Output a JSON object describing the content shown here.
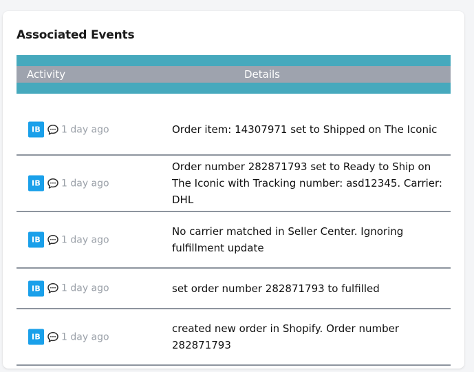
{
  "panel": {
    "title": "Associated Events"
  },
  "table": {
    "headers": {
      "activity": "Activity",
      "details": "Details"
    },
    "rows": [
      {
        "badge": "IB",
        "icon": "comment-icon",
        "time": "1 day ago",
        "details": "Order item: 14307971 set to Shipped on The Iconic"
      },
      {
        "badge": "IB",
        "icon": "comment-icon",
        "time": "1 day ago",
        "details": "Order number 282871793 set to Ready to Ship on The Iconic with Tracking number: asd12345. Carrier: DHL"
      },
      {
        "badge": "IB",
        "icon": "comment-icon",
        "time": "1 day ago",
        "details": "No carrier matched in Seller Center. Ignoring fulfillment update"
      },
      {
        "badge": "IB",
        "icon": "comment-icon",
        "time": "1 day ago",
        "details": "set order number 282871793 to fulfilled"
      },
      {
        "badge": "IB",
        "icon": "comment-icon",
        "time": "1 day ago",
        "details": "created new order in Shopify. Order number 282871793"
      }
    ]
  },
  "colors": {
    "header_teal": "#46a9bd",
    "header_gray": "#9ea3ae",
    "badge_blue": "#1aa0ea",
    "row_divider": "#8d949e"
  }
}
